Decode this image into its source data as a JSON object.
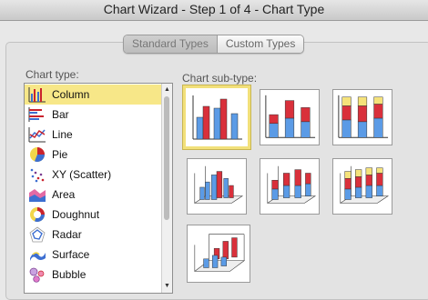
{
  "window": {
    "title": "Chart Wizard - Step 1 of 4 - Chart Type"
  },
  "tabs": [
    {
      "label": "Standard Types",
      "selected": true
    },
    {
      "label": "Custom Types",
      "selected": false
    }
  ],
  "chart_type_label": "Chart type:",
  "chart_subtype_label": "Chart sub-type:",
  "chart_types": [
    {
      "label": "Column",
      "icon": "column-chart-icon",
      "selected": true
    },
    {
      "label": "Bar",
      "icon": "bar-chart-icon",
      "selected": false
    },
    {
      "label": "Line",
      "icon": "line-chart-icon",
      "selected": false
    },
    {
      "label": "Pie",
      "icon": "pie-chart-icon",
      "selected": false
    },
    {
      "label": "XY (Scatter)",
      "icon": "scatter-chart-icon",
      "selected": false
    },
    {
      "label": "Area",
      "icon": "area-chart-icon",
      "selected": false
    },
    {
      "label": "Doughnut",
      "icon": "doughnut-chart-icon",
      "selected": false
    },
    {
      "label": "Radar",
      "icon": "radar-chart-icon",
      "selected": false
    },
    {
      "label": "Surface",
      "icon": "surface-chart-icon",
      "selected": false
    },
    {
      "label": "Bubble",
      "icon": "bubble-chart-icon",
      "selected": false
    }
  ],
  "subtypes": [
    {
      "name": "clustered-column",
      "selected": true
    },
    {
      "name": "stacked-column",
      "selected": false
    },
    {
      "name": "100-percent-stacked-column",
      "selected": false
    },
    {
      "name": "3d-clustered-column",
      "selected": false
    },
    {
      "name": "3d-stacked-column",
      "selected": false
    },
    {
      "name": "3d-100-percent-stacked-column",
      "selected": false
    },
    {
      "name": "3d-column",
      "selected": false
    }
  ],
  "colors": {
    "selection": "#f7e788",
    "series_blue": "#5b9be6",
    "series_red": "#d9303b",
    "series_yellow": "#f5e27a"
  }
}
